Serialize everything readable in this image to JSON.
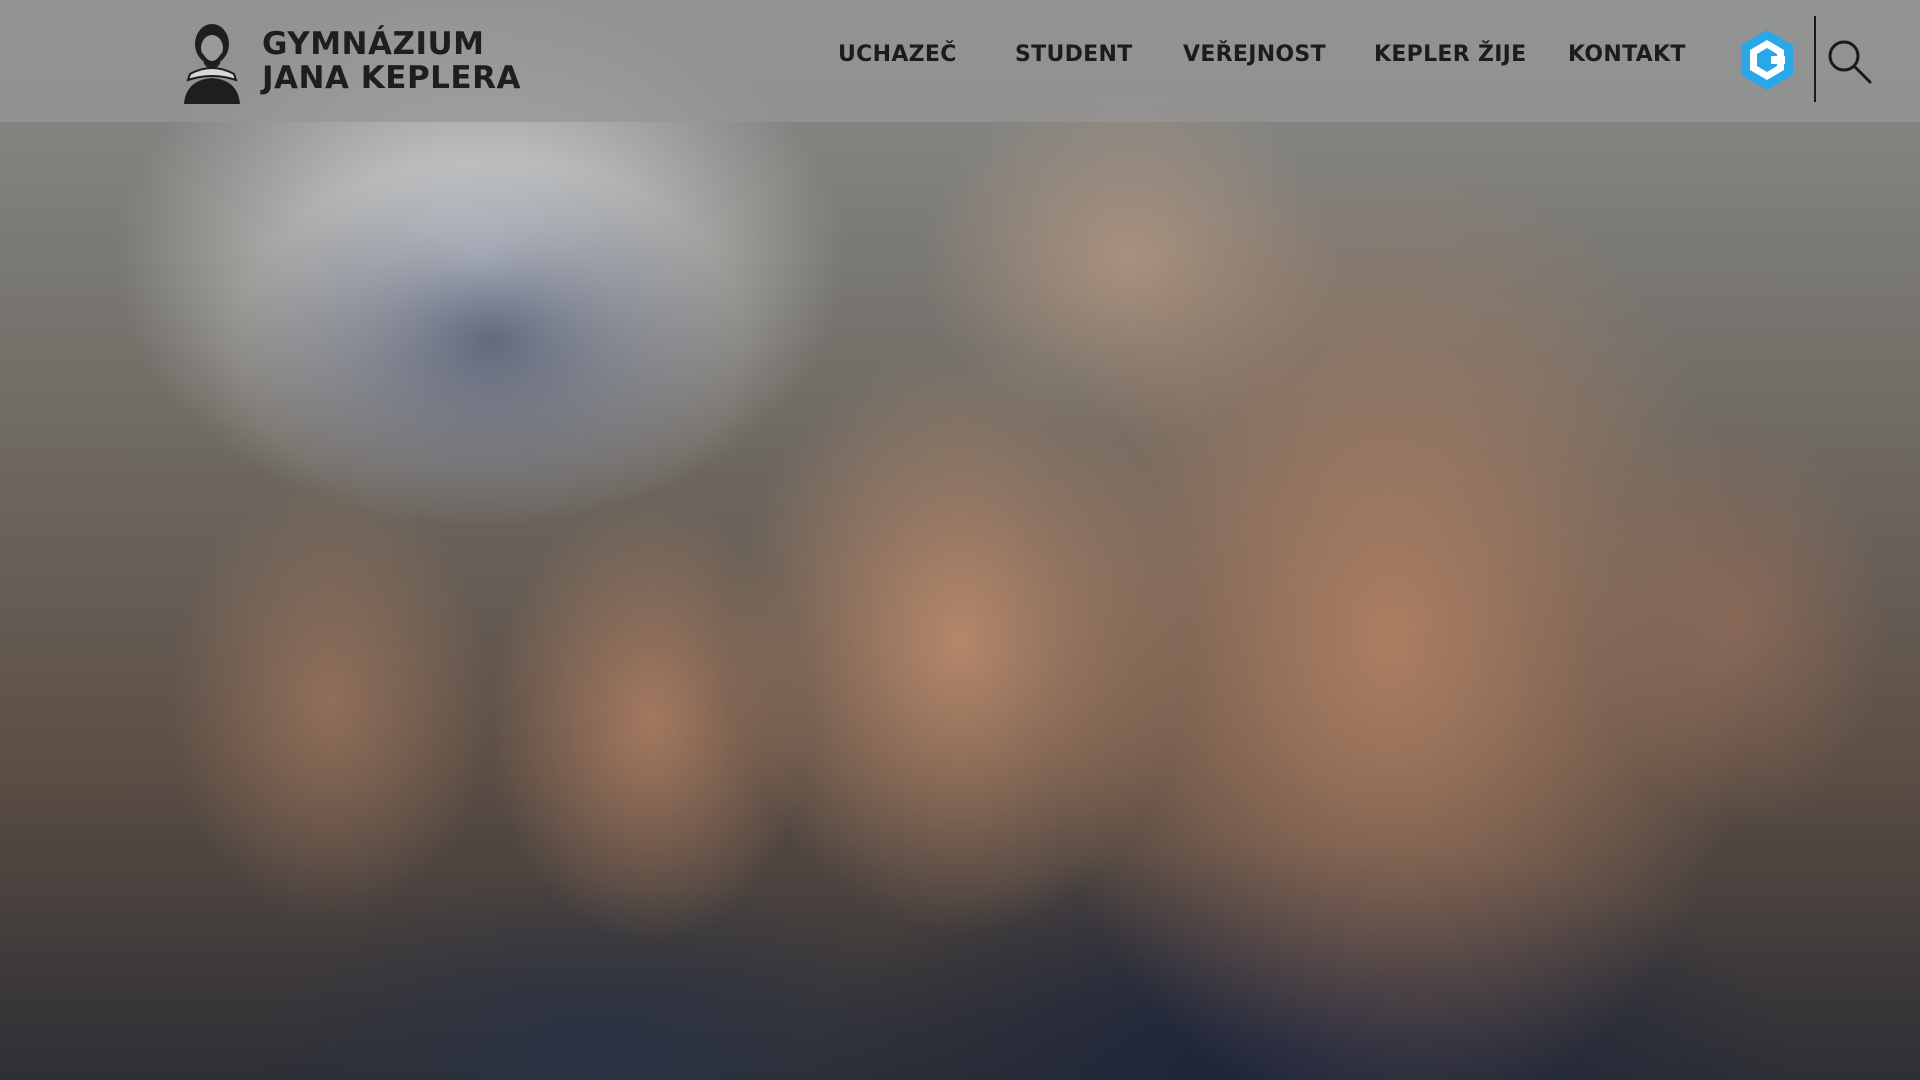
{
  "logo": {
    "line1": "GYMNÁZIUM",
    "line2": "JANA KEPLERA",
    "icon": "kepler-portrait-icon"
  },
  "nav": {
    "items": [
      {
        "label": "UCHAZEČ"
      },
      {
        "label": "STUDENT"
      },
      {
        "label": "VEŘEJNOST"
      },
      {
        "label": "KEPLER ŽIJE"
      },
      {
        "label": "KONTAKT"
      }
    ]
  },
  "icons": {
    "brand": "hexagon-c-icon",
    "search": "search-icon"
  },
  "colors": {
    "header_bg": "#969696",
    "text": "#1c1c1c",
    "brand_accent": "#2aa7e6"
  }
}
